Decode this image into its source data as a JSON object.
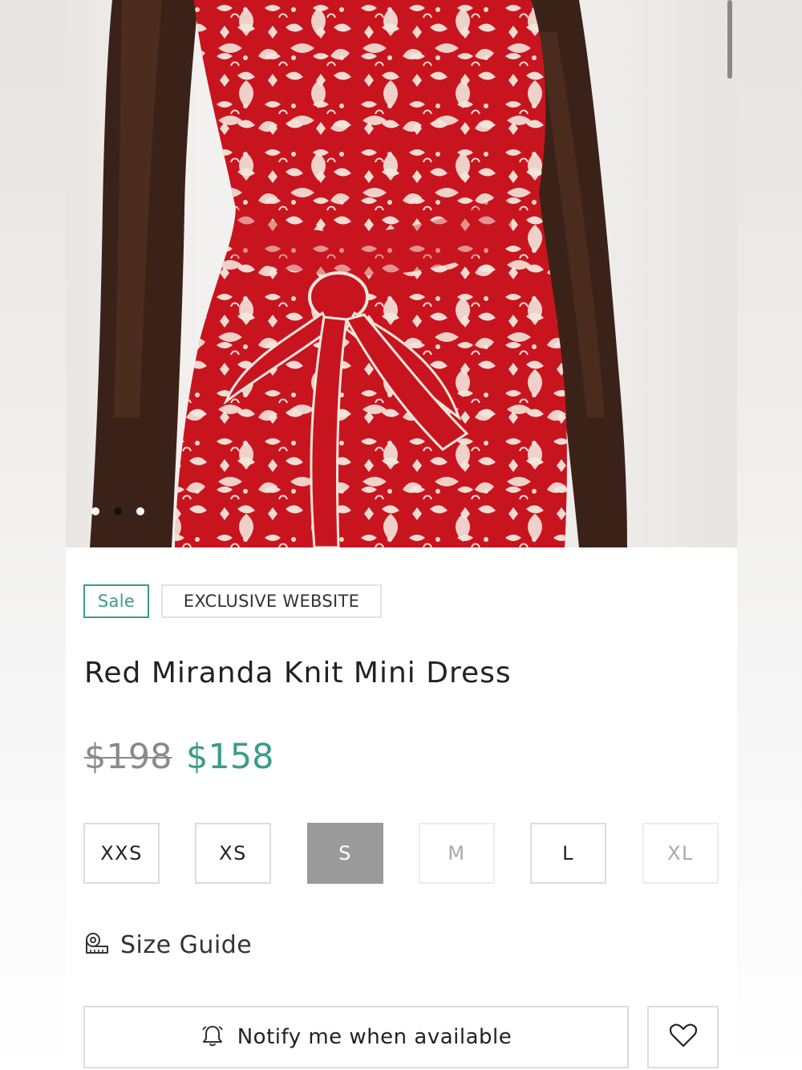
{
  "product": {
    "image_alt": "Red Miranda Knit Mini Dress",
    "carousel": {
      "count": 3,
      "active_index": 1
    },
    "badges": {
      "sale": "Sale",
      "exclusive": "EXCLUSIVE WEBSITE"
    },
    "title": "Red Miranda Knit Mini Dress",
    "price_original": "$198",
    "price_sale": "$158"
  },
  "sizes": [
    {
      "label": "XXS",
      "state": "available"
    },
    {
      "label": "XS",
      "state": "available"
    },
    {
      "label": "S",
      "state": "selected"
    },
    {
      "label": "M",
      "state": "unavailable"
    },
    {
      "label": "L",
      "state": "available"
    },
    {
      "label": "XL",
      "state": "unavailable"
    }
  ],
  "size_guide": {
    "label": "Size Guide",
    "icon": "measuring-tape-icon"
  },
  "actions": {
    "notify_label": "Notify me when available",
    "notify_icon": "bell-icon",
    "wishlist_icon": "heart-icon"
  },
  "colors": {
    "accent": "#3a9c88",
    "dress_red": "#c8141e",
    "pattern_cream": "#f3e6dc",
    "selected_size_bg": "#9a9a9a"
  }
}
